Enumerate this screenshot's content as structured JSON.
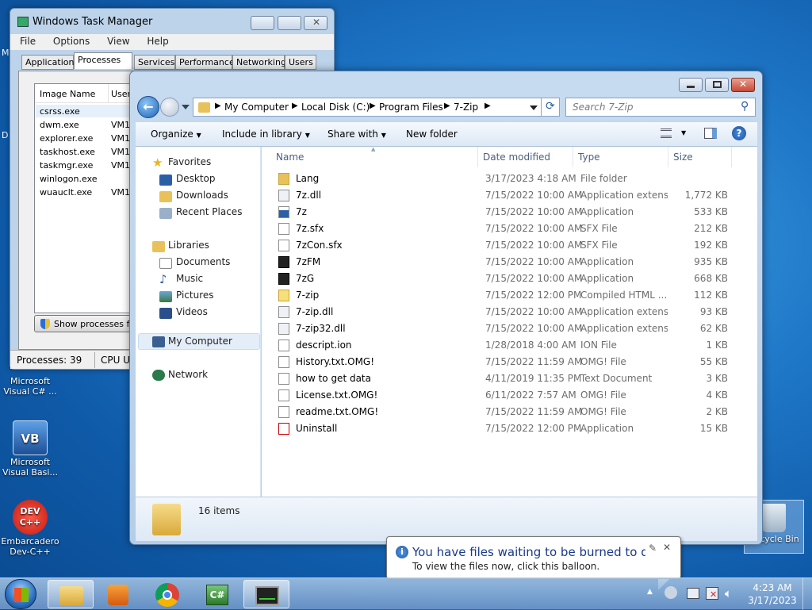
{
  "desktop": {
    "icons": [
      {
        "label": "Microsoft\nVisual C# ..."
      },
      {
        "label": "Microsoft\nVisual Basi..."
      },
      {
        "label": "Embarcadero\nDev-C++"
      },
      {
        "label": "Recycle Bin"
      }
    ],
    "partial_left_letters": [
      "M",
      "D"
    ]
  },
  "taskmgr": {
    "title": "Windows Task Manager",
    "menu": [
      "File",
      "Options",
      "View",
      "Help"
    ],
    "tabs": [
      "Applications",
      "Processes",
      "Services",
      "Performance",
      "Networking",
      "Users"
    ],
    "columns": [
      "Image Name",
      "User"
    ],
    "rows": [
      {
        "name": "csrss.exe",
        "user": ""
      },
      {
        "name": "dwm.exe",
        "user": "VM1"
      },
      {
        "name": "explorer.exe",
        "user": "VM1"
      },
      {
        "name": "taskhost.exe",
        "user": "VM1"
      },
      {
        "name": "taskmgr.exe",
        "user": "VM1"
      },
      {
        "name": "winlogon.exe",
        "user": ""
      },
      {
        "name": "wuauclt.exe",
        "user": "VM1"
      }
    ],
    "show_processes_label": "Show processes fro",
    "status_processes": "Processes: 39",
    "status_cpu": "CPU Us"
  },
  "explorer": {
    "breadcrumb": [
      "My Computer",
      "Local Disk (C:)",
      "Program Files",
      "7-Zip"
    ],
    "search_placeholder": "Search 7-Zip",
    "toolbar": {
      "organize": "Organize",
      "include": "Include in library",
      "share": "Share with",
      "newfolder": "New folder"
    },
    "nav": {
      "favorites": "Favorites",
      "desktop": "Desktop",
      "downloads": "Downloads",
      "recent": "Recent Places",
      "libraries": "Libraries",
      "documents": "Documents",
      "music": "Music",
      "pictures": "Pictures",
      "videos": "Videos",
      "computer": "My Computer",
      "network": "Network"
    },
    "columns": {
      "name": "Name",
      "date": "Date modified",
      "type": "Type",
      "size": "Size"
    },
    "files": [
      {
        "name": "Lang",
        "date": "3/17/2023 4:18 AM",
        "type": "File folder",
        "size": "",
        "icon": "folder"
      },
      {
        "name": "7z.dll",
        "date": "7/15/2022 10:00 AM",
        "type": "Application extens...",
        "size": "1,772 KB",
        "icon": "dll"
      },
      {
        "name": "7z",
        "date": "7/15/2022 10:00 AM",
        "type": "Application",
        "size": "533 KB",
        "icon": "app"
      },
      {
        "name": "7z.sfx",
        "date": "7/15/2022 10:00 AM",
        "type": "SFX File",
        "size": "212 KB",
        "icon": "blank"
      },
      {
        "name": "7zCon.sfx",
        "date": "7/15/2022 10:00 AM",
        "type": "SFX File",
        "size": "192 KB",
        "icon": "blank"
      },
      {
        "name": "7zFM",
        "date": "7/15/2022 10:00 AM",
        "type": "Application",
        "size": "935 KB",
        "icon": "7z"
      },
      {
        "name": "7zG",
        "date": "7/15/2022 10:00 AM",
        "type": "Application",
        "size": "668 KB",
        "icon": "7z"
      },
      {
        "name": "7-zip",
        "date": "7/15/2022 12:00 PM",
        "type": "Compiled HTML ...",
        "size": "112 KB",
        "icon": "help"
      },
      {
        "name": "7-zip.dll",
        "date": "7/15/2022 10:00 AM",
        "type": "Application extens...",
        "size": "93 KB",
        "icon": "dll"
      },
      {
        "name": "7-zip32.dll",
        "date": "7/15/2022 10:00 AM",
        "type": "Application extens...",
        "size": "62 KB",
        "icon": "dll"
      },
      {
        "name": "descript.ion",
        "date": "1/28/2018 4:00 AM",
        "type": "ION File",
        "size": "1 KB",
        "icon": "blank"
      },
      {
        "name": "History.txt.OMG!",
        "date": "7/15/2022 11:59 AM",
        "type": "OMG! File",
        "size": "55 KB",
        "icon": "blank"
      },
      {
        "name": "how to get data",
        "date": "4/11/2019 11:35 PM",
        "type": "Text Document",
        "size": "3 KB",
        "icon": "blank"
      },
      {
        "name": "License.txt.OMG!",
        "date": "6/11/2022 7:57 AM",
        "type": "OMG! File",
        "size": "4 KB",
        "icon": "blank"
      },
      {
        "name": "readme.txt.OMG!",
        "date": "7/15/2022 11:59 AM",
        "type": "OMG! File",
        "size": "2 KB",
        "icon": "blank"
      },
      {
        "name": "Uninstall",
        "date": "7/15/2022 12:00 PM",
        "type": "Application",
        "size": "15 KB",
        "icon": "uninstall"
      }
    ],
    "item_count": "16 items"
  },
  "balloon": {
    "title": "You have files waiting to be burned to disc",
    "body": "To view the files now, click this balloon."
  },
  "clock": {
    "time": "4:23 AM",
    "date": "3/17/2023"
  },
  "colors": {
    "accent": "#1f78c8",
    "folder": "#e8c15a",
    "close": "#c74a34"
  }
}
